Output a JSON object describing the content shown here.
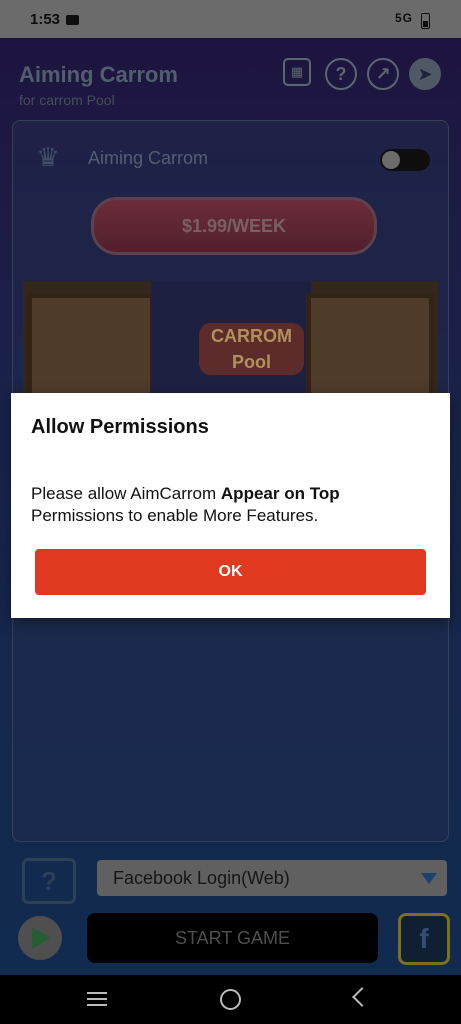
{
  "status_bar": {
    "time": "1:53",
    "network": "5G"
  },
  "header": {
    "title": "Aiming Carrom",
    "subtitle": "for carrom Pool"
  },
  "card": {
    "name": "Aiming Carrom",
    "price_label": "$1.99/WEEK",
    "banner_logo_line1": "CARROM",
    "banner_logo_line2": "Pool"
  },
  "login": {
    "selected": "Facebook Login(Web)"
  },
  "start_label": "START GAME",
  "dialog": {
    "title": "Allow Permissions",
    "message_prefix": "Please allow AimCarrom ",
    "message_bold": "Appear on Top",
    "message_suffix": " Permissions to enable More Features.",
    "ok_label": "OK"
  },
  "colors": {
    "accent": "#e0391f",
    "dialog_bg": "#ffffff"
  }
}
